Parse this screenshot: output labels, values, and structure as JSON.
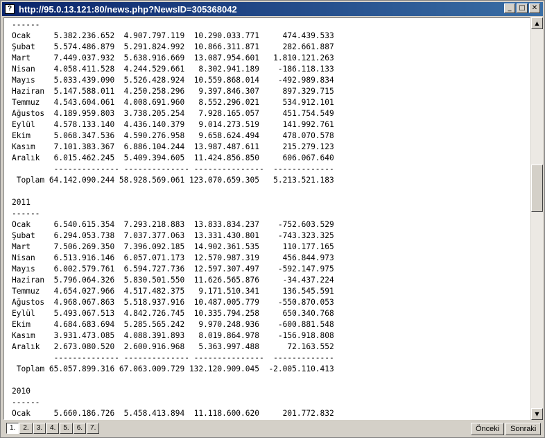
{
  "window": {
    "title": "http://95.0.13.121:80/news.php?NewsID=305368042",
    "icon_label": "?",
    "minimize": "_",
    "maximize": "□",
    "close": "✕"
  },
  "report_lines": [
    "------",
    "Ocak     5.382.236.652  4.907.797.119  10.290.033.771     474.439.533",
    "Şubat    5.574.486.879  5.291.824.992  10.866.311.871     282.661.887",
    "Mart     7.449.037.932  5.638.916.669  13.087.954.601   1.810.121.263",
    "Nisan    4.058.411.528  4.244.529.661   8.302.941.189    -186.118.133",
    "Mayıs    5.033.439.090  5.526.428.924  10.559.868.014    -492.989.834",
    "Haziran  5.147.588.011  4.250.258.296   9.397.846.307     897.329.715",
    "Temmuz   4.543.604.061  4.008.691.960   8.552.296.021     534.912.101",
    "Ağustos  4.189.959.803  3.738.205.254   7.928.165.057     451.754.549",
    "Eylül    4.578.133.140  4.436.140.379   9.014.273.519     141.992.761",
    "Ekim     5.068.347.536  4.590.276.958   9.658.624.494     478.070.578",
    "Kasım    7.101.383.367  6.886.104.244  13.987.487.611     215.279.123",
    "Aralık   6.015.462.245  5.409.394.605  11.424.856.850     606.067.640",
    "         -------------- -------------- ---------------  -------------",
    " Toplam 64.142.090.244 58.928.569.061 123.070.659.305   5.213.521.183",
    "",
    "2011",
    "------",
    "Ocak     6.540.615.354  7.293.218.883  13.833.834.237    -752.603.529",
    "Şubat    6.294.053.738  7.037.377.063  13.331.430.801    -743.323.325",
    "Mart     7.506.269.350  7.396.092.185  14.902.361.535     110.177.165",
    "Nisan    6.513.916.146  6.057.071.173  12.570.987.319     456.844.973",
    "Mayıs    6.002.579.761  6.594.727.736  12.597.307.497    -592.147.975",
    "Haziran  5.796.064.326  5.830.501.550  11.626.565.876     -34.437.224",
    "Temmuz   4.654.027.966  4.517.482.375   9.171.510.341     136.545.591",
    "Ağustos  4.968.067.863  5.518.937.916  10.487.005.779    -550.870.053",
    "Eylül    5.493.067.513  4.842.726.745  10.335.794.258     650.340.768",
    "Ekim     4.684.683.694  5.285.565.242   9.970.248.936    -600.881.548",
    "Kasım    3.931.473.085  4.088.391.893   8.019.864.978    -156.918.808",
    "Aralık   2.673.080.520  2.600.916.968   5.363.997.488      72.163.552",
    "         -------------- -------------- ---------------  -------------",
    " Toplam 65.057.899.316 67.063.009.729 132.120.909.045  -2.005.110.413",
    "",
    "2010",
    "------",
    "Ocak     5.660.186.726  5.458.413.894  11.118.600.620     201.772.832"
  ],
  "scrollbar": {
    "up_arrow": "▲",
    "down_arrow": "▼"
  },
  "pagination": {
    "pages": [
      "1.",
      "2.",
      "3.",
      "4.",
      "5.",
      "6.",
      "7."
    ],
    "active_index": 0,
    "prev_label": "Önceki",
    "next_label": "Sonraki"
  }
}
